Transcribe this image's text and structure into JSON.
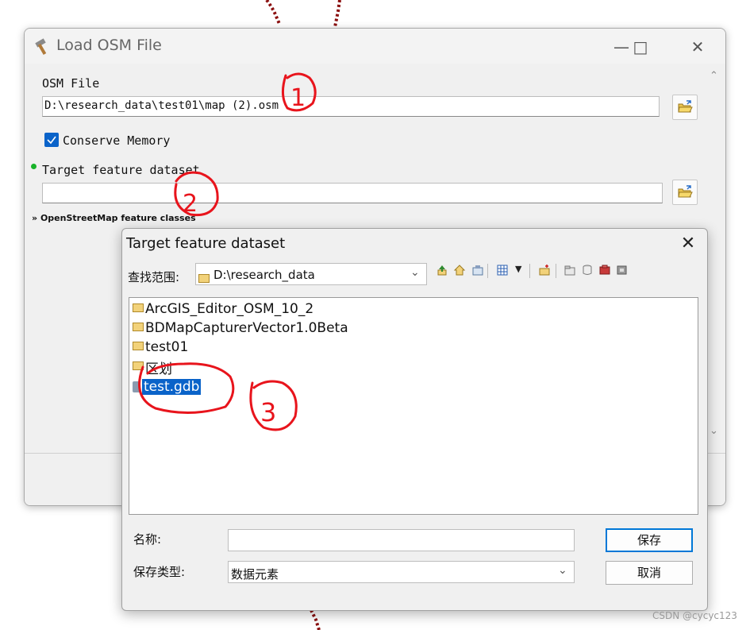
{
  "main_window": {
    "title": "Load OSM File",
    "osm_file_label": "OSM File",
    "osm_file_value": "D:\\research_data\\test01\\map (2).osm",
    "conserve_memory_label": "Conserve Memory",
    "conserve_memory_checked": true,
    "target_dataset_label": "Target feature dataset",
    "target_dataset_value": "",
    "feature_classes_label": "OpenStreetMap feature classes",
    "icons": [
      "hammer-icon",
      "minimize-icon",
      "maximize-icon",
      "close-icon",
      "open-folder-icon"
    ]
  },
  "dialog": {
    "title": "Target feature dataset",
    "look_in_label": "查找范围:",
    "look_in_value": "D:\\research_data",
    "items": [
      {
        "name": "ArcGIS_Editor_OSM_10_2",
        "type": "folder",
        "selected": false
      },
      {
        "name": "BDMapCapturerVector1.0Beta",
        "type": "folder",
        "selected": false
      },
      {
        "name": "test01",
        "type": "folder",
        "selected": false
      },
      {
        "name": "区划",
        "type": "folder",
        "selected": false
      },
      {
        "name": "test.gdb",
        "type": "geodatabase",
        "selected": true
      }
    ],
    "name_label": "名称:",
    "name_value": "",
    "save_type_label": "保存类型:",
    "save_type_value": "数据元素",
    "save_button": "保存",
    "cancel_button": "取消"
  },
  "annotations": [
    "1",
    "2",
    "3"
  ],
  "watermark": "CSDN @cycyc123",
  "colors": {
    "accent": "#0a63c9",
    "annotation_red": "#e8141c",
    "window_bg": "#f0f0f0"
  }
}
